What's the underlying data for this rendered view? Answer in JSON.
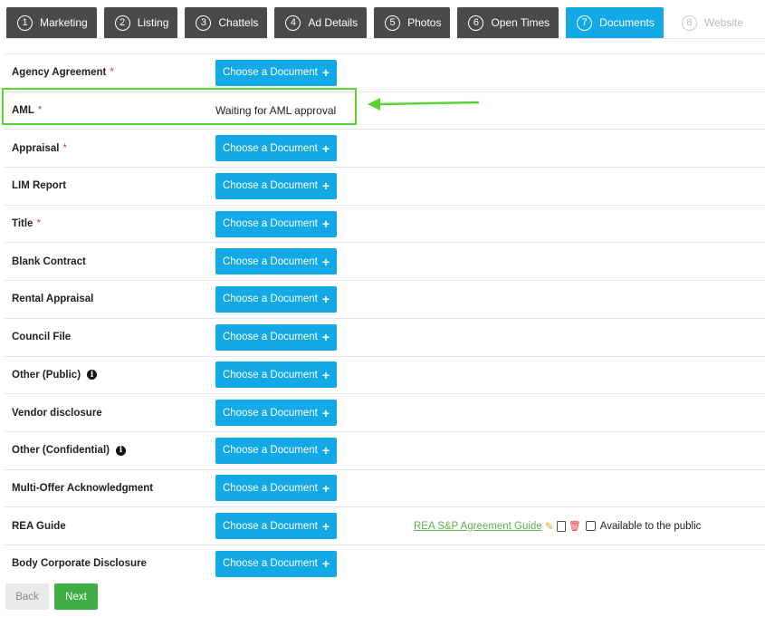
{
  "tabs": [
    {
      "num": "1",
      "label": "Marketing",
      "state": "normal"
    },
    {
      "num": "2",
      "label": "Listing",
      "state": "normal"
    },
    {
      "num": "3",
      "label": "Chattels",
      "state": "normal"
    },
    {
      "num": "4",
      "label": "Ad Details",
      "state": "normal"
    },
    {
      "num": "5",
      "label": "Photos",
      "state": "normal"
    },
    {
      "num": "6",
      "label": "Open Times",
      "state": "normal"
    },
    {
      "num": "7",
      "label": "Documents",
      "state": "active"
    },
    {
      "num": "8",
      "label": "Website",
      "state": "disabled"
    }
  ],
  "choose_label": "Choose a Document",
  "rows": [
    {
      "label": "Agency Agreement",
      "required": true,
      "info": false,
      "type": "button"
    },
    {
      "label": "AML",
      "required": true,
      "info": false,
      "type": "status",
      "status": "Waiting for AML approval"
    },
    {
      "label": "Appraisal",
      "required": true,
      "info": false,
      "type": "button"
    },
    {
      "label": "LIM Report",
      "required": false,
      "info": false,
      "type": "button"
    },
    {
      "label": "Title",
      "required": true,
      "info": false,
      "type": "button"
    },
    {
      "label": "Blank Contract",
      "required": false,
      "info": false,
      "type": "button"
    },
    {
      "label": "Rental Appraisal",
      "required": false,
      "info": false,
      "type": "button"
    },
    {
      "label": "Council File",
      "required": false,
      "info": false,
      "type": "button"
    },
    {
      "label": "Other (Public)",
      "required": false,
      "info": true,
      "type": "button"
    },
    {
      "label": "Vendor disclosure",
      "required": false,
      "info": false,
      "type": "button"
    },
    {
      "label": "Other (Confidential)",
      "required": false,
      "info": true,
      "type": "button"
    },
    {
      "label": "Multi-Offer Acknowledgment",
      "required": false,
      "info": false,
      "type": "button"
    },
    {
      "label": "REA Guide",
      "required": false,
      "info": false,
      "type": "button",
      "attachment": {
        "link": "REA S&P Agreement Guide",
        "public_label": "Available to the public"
      }
    },
    {
      "label": "Body Corporate Disclosure",
      "required": false,
      "info": false,
      "type": "button"
    }
  ],
  "footer": {
    "back": "Back",
    "next": "Next"
  },
  "colors": {
    "accent": "#13a9e6",
    "highlight": "#58d431",
    "next": "#3fad46",
    "required": "#e0413d"
  }
}
